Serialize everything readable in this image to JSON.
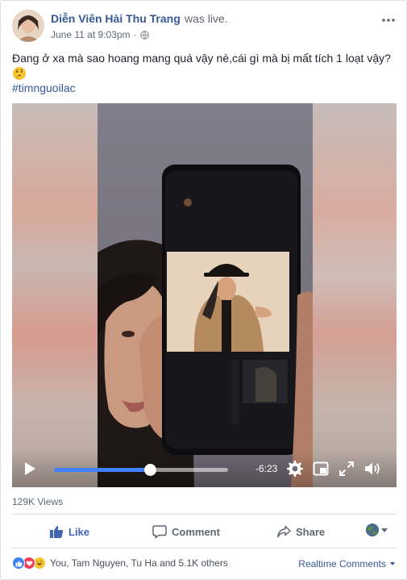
{
  "post": {
    "author": "Diễn Viên Hài Thu Trang",
    "activity": "was live.",
    "timestamp": "June 11 at 9:03pm",
    "audience_separator": "·",
    "text": "Đang ở xa mà sao hoang mang quá vậy nè,cái gì mà bị mất tích 1 loạt vậy?",
    "emoji": "thinking-face",
    "hashtag": "#timnguoilac"
  },
  "video": {
    "progress_fraction": 0.55,
    "time_remaining": "-6:23",
    "accent_color": "#4080ff",
    "icons": [
      "play-icon",
      "settings-gear-icon",
      "picture-in-picture-icon",
      "fullscreen-icon",
      "volume-icon"
    ]
  },
  "stats": {
    "views": "129K Views"
  },
  "actions": {
    "like": "Like",
    "comment": "Comment",
    "share": "Share",
    "like_color": "#4267b2"
  },
  "reactions": {
    "types": [
      "like",
      "love",
      "haha"
    ],
    "summary": "You, Tam Nguyen, Tu Ha and 5.1K others"
  },
  "comments": {
    "order": "Realtime Comments"
  }
}
